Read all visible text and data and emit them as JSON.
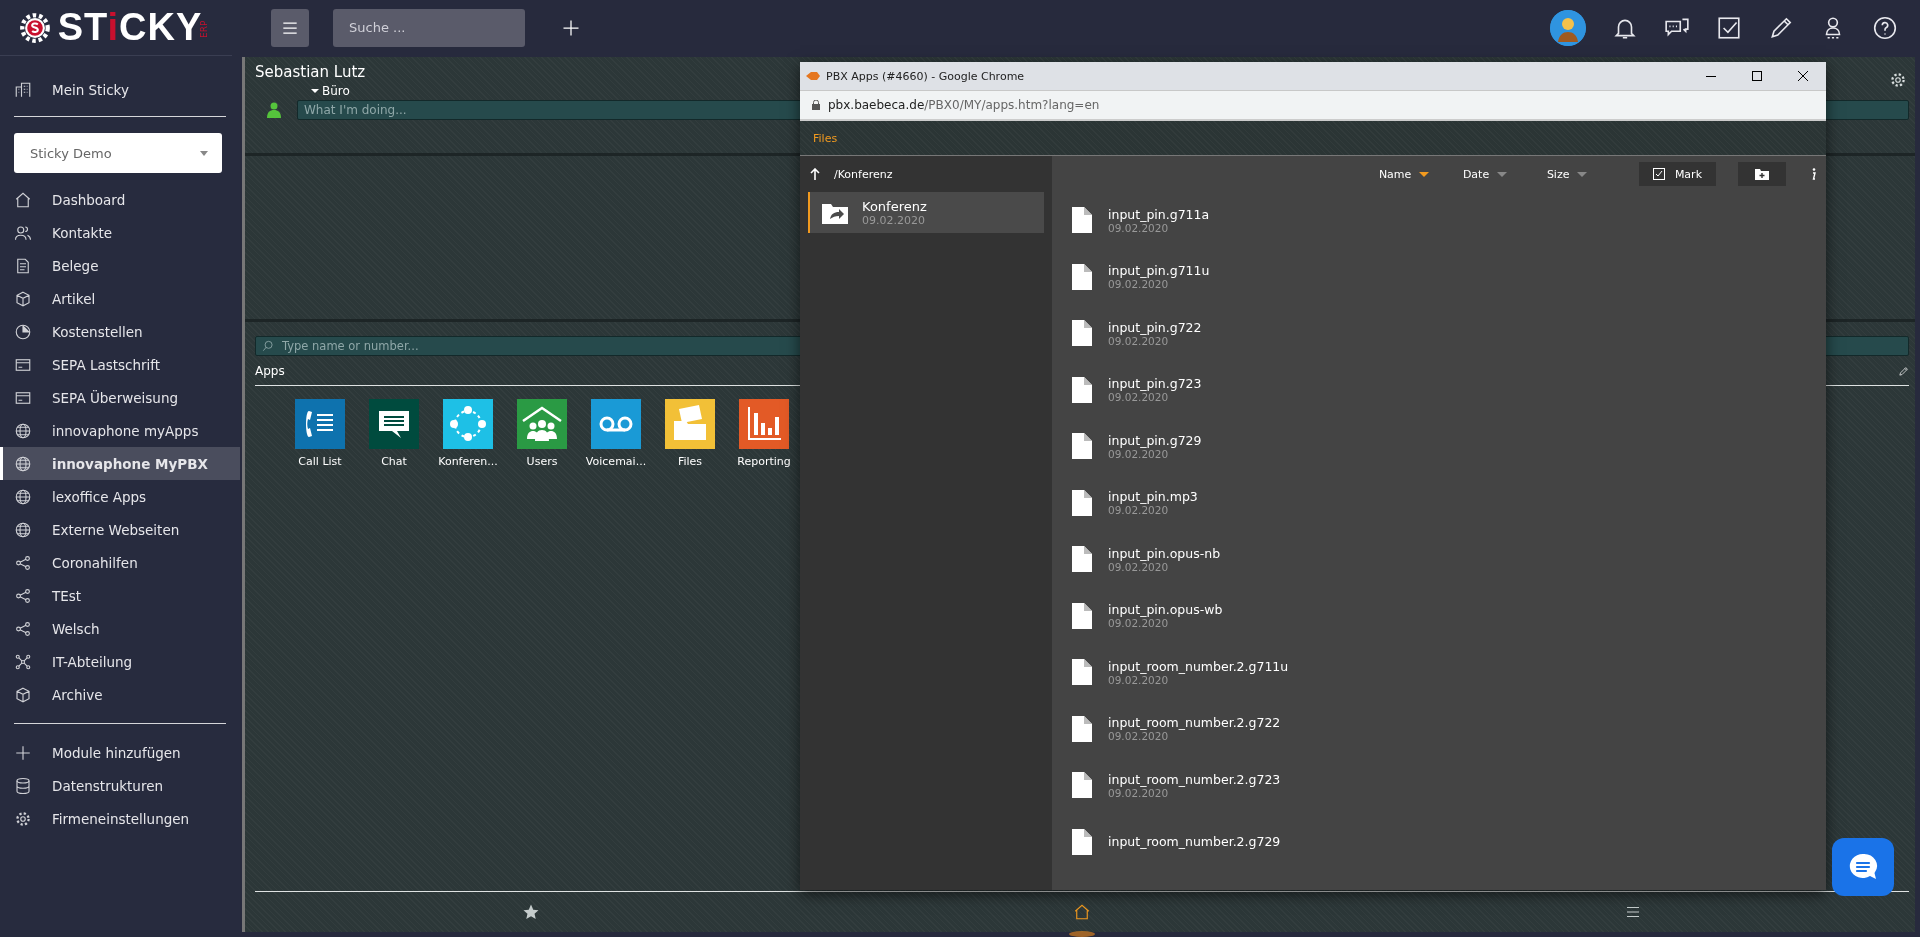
{
  "logo": {
    "parts": [
      {
        "text": "ST",
        "accent": false
      },
      {
        "text": "i",
        "accent": true
      },
      {
        "text": "CKY",
        "accent": false
      }
    ],
    "badge": "ERP"
  },
  "sidebar": {
    "top_item": {
      "label": "Mein Sticky",
      "kind": "building"
    },
    "workspace": "Sticky Demo",
    "items": [
      {
        "label": "Dashboard",
        "kind": "home",
        "selected": false
      },
      {
        "label": "Kontakte",
        "kind": "contacts",
        "selected": false
      },
      {
        "label": "Belege",
        "kind": "doc",
        "selected": false
      },
      {
        "label": "Artikel",
        "kind": "box",
        "selected": false
      },
      {
        "label": "Kostenstellen",
        "kind": "pie",
        "selected": false
      },
      {
        "label": "SEPA Lastschrift",
        "kind": "card",
        "selected": false
      },
      {
        "label": "SEPA Überweisung",
        "kind": "card",
        "selected": false
      },
      {
        "label": "innovaphone myApps",
        "kind": "globe",
        "selected": false
      },
      {
        "label": "innovaphone MyPBX",
        "kind": "globe",
        "selected": true
      },
      {
        "label": "lexoffice Apps",
        "kind": "globe",
        "selected": false
      },
      {
        "label": "Externe Webseiten",
        "kind": "globe",
        "selected": false
      },
      {
        "label": "Coronahilfen",
        "kind": "share",
        "selected": false
      },
      {
        "label": "TEst",
        "kind": "share",
        "selected": false
      },
      {
        "label": "Welsch",
        "kind": "share",
        "selected": false
      },
      {
        "label": "IT-Abteilung",
        "kind": "network",
        "selected": false
      },
      {
        "label": "Archive",
        "kind": "box",
        "selected": false
      }
    ],
    "bottom_items": [
      {
        "label": "Module hinzufügen",
        "kind": "plus"
      },
      {
        "label": "Datenstrukturen",
        "kind": "db"
      },
      {
        "label": "Firmeneinstellungen",
        "kind": "gear"
      }
    ]
  },
  "topbar": {
    "search_placeholder": "Suche ..."
  },
  "profile": {
    "name": "Sebastian Lutz",
    "location": "Büro",
    "status_placeholder": "What I'm doing..."
  },
  "apps": {
    "search_placeholder": "Type name or number...",
    "title": "Apps",
    "items": [
      {
        "label": "Call List",
        "color": "#0e72ae",
        "kind": "calllist"
      },
      {
        "label": "Chat",
        "color": "#004b3e",
        "kind": "chat"
      },
      {
        "label": "Konferen...",
        "color": "#1ec0e6",
        "kind": "conference"
      },
      {
        "label": "Users",
        "color": "#2a9a44",
        "kind": "users"
      },
      {
        "label": "Voicemai...",
        "color": "#1a9ad6",
        "kind": "voicemail"
      },
      {
        "label": "Files",
        "color": "#f2c037",
        "kind": "files"
      },
      {
        "label": "Reporting",
        "color": "#e35a26",
        "kind": "reporting"
      }
    ]
  },
  "popup": {
    "title": "PBX Apps (#4660) - Google Chrome",
    "url_host": "pbx.baebeca.de",
    "url_path": "/PBX0/MY/apps.htm?lang=en",
    "tab": "Files",
    "path": "/Konferenz",
    "folders": [
      {
        "name": "Konferenz",
        "date": "09.02.2020",
        "selected": true
      }
    ],
    "columns": [
      {
        "label": "Name",
        "selected": true
      },
      {
        "label": "Date",
        "selected": false
      },
      {
        "label": "Size",
        "selected": false
      }
    ],
    "mark": "Mark",
    "files": [
      {
        "name": "input_pin.g711a",
        "date": "09.02.2020"
      },
      {
        "name": "input_pin.g711u",
        "date": "09.02.2020"
      },
      {
        "name": "input_pin.g722",
        "date": "09.02.2020"
      },
      {
        "name": "input_pin.g723",
        "date": "09.02.2020"
      },
      {
        "name": "input_pin.g729",
        "date": "09.02.2020"
      },
      {
        "name": "input_pin.mp3",
        "date": "09.02.2020"
      },
      {
        "name": "input_pin.opus-nb",
        "date": "09.02.2020"
      },
      {
        "name": "input_pin.opus-wb",
        "date": "09.02.2020"
      },
      {
        "name": "input_room_number.2.g711u",
        "date": "09.02.2020"
      },
      {
        "name": "input_room_number.2.g722",
        "date": "09.02.2020"
      },
      {
        "name": "input_room_number.2.g723",
        "date": "09.02.2020"
      },
      {
        "name": "input_room_number.2.g729"
      }
    ]
  },
  "bottom_nav": [
    {
      "kind": "star",
      "selected": false
    },
    {
      "kind": "home",
      "selected": true
    },
    {
      "kind": "menu",
      "selected": false
    }
  ]
}
